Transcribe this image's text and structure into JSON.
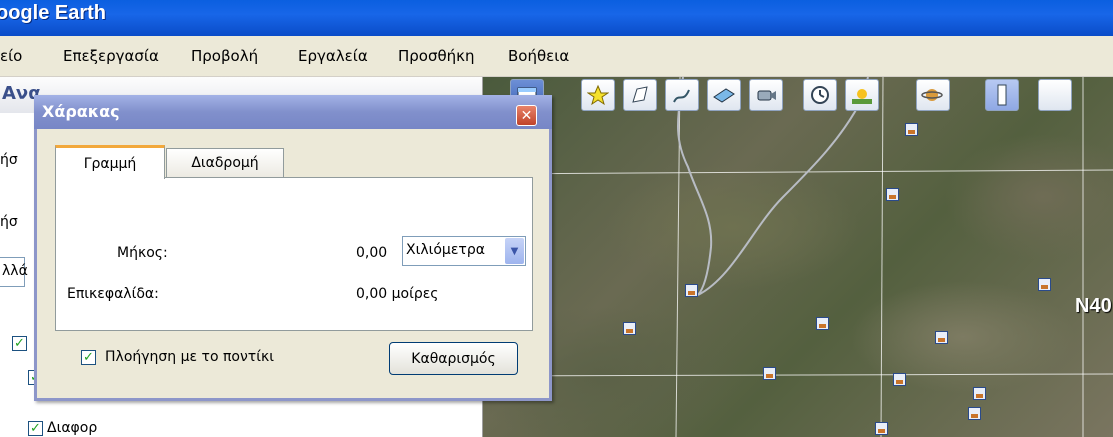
{
  "app": {
    "title": "oogle Earth"
  },
  "menu": [
    "είο",
    "Επεξεργασία",
    "Προβολή",
    "Εργαλεία",
    "Προσθήκη",
    "Βοήθεια"
  ],
  "left_panel": {
    "header": "Ανα",
    "fragments": [
      "ήσ",
      "ήσ"
    ],
    "input_value": "λλά",
    "layers": [
      {
        "checked": true,
        "label": ""
      },
      {
        "checked": true,
        "label": ""
      },
      {
        "checked": true,
        "label": "Διαφορ"
      }
    ]
  },
  "map": {
    "coord_label": "N40",
    "toolbar_icons": [
      "sidebar-toggle-icon",
      "placemark-icon",
      "polygon-icon",
      "path-icon",
      "image-overlay-icon",
      "record-tour-icon",
      "historical-imagery-icon",
      "sunlight-icon",
      "planets-icon",
      "ruler-icon"
    ]
  },
  "ruler_dialog": {
    "title": "Χάρακας",
    "tabs": [
      "Γραμμή",
      "Διαδρομή"
    ],
    "active_tab": "Γραμμή",
    "length_label": "Μήκος:",
    "length_value": "0,00",
    "unit": "Χιλιόμετρα",
    "heading_label": "Επικεφαλίδα:",
    "heading_value": "0,00 μοίρες",
    "mouse_nav_label": "Πλοήγηση με το ποντίκι",
    "mouse_nav_checked": true,
    "clear_button": "Καθαρισμός"
  }
}
